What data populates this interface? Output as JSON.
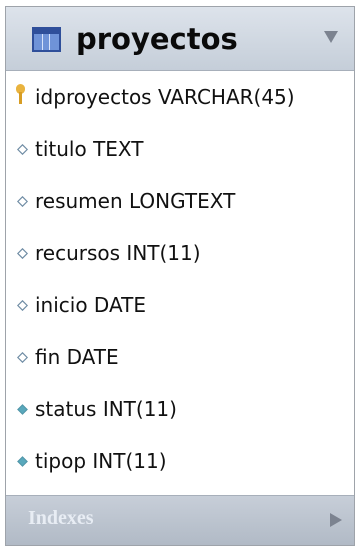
{
  "table": {
    "name": "proyectos",
    "columns": [
      {
        "text": "idproyectos VARCHAR(45)",
        "kind": "primary-key",
        "icon": "key-icon"
      },
      {
        "text": "titulo TEXT",
        "kind": "nullable",
        "icon": "diamond-outline-icon"
      },
      {
        "text": "resumen LONGTEXT",
        "kind": "nullable",
        "icon": "diamond-outline-icon"
      },
      {
        "text": "recursos INT(11)",
        "kind": "nullable",
        "icon": "diamond-outline-icon"
      },
      {
        "text": "inicio DATE",
        "kind": "nullable",
        "icon": "diamond-outline-icon"
      },
      {
        "text": "fin DATE",
        "kind": "nullable",
        "icon": "diamond-outline-icon"
      },
      {
        "text": "status INT(11)",
        "kind": "not-null",
        "icon": "diamond-filled-icon"
      },
      {
        "text": "tipop INT(11)",
        "kind": "not-null",
        "icon": "diamond-filled-icon"
      }
    ]
  },
  "footer": {
    "label": "Indexes"
  },
  "colors": {
    "diamond_outline": "#6f8ca4",
    "diamond_fill": "#59a8bc",
    "key": "#e9b33e"
  }
}
